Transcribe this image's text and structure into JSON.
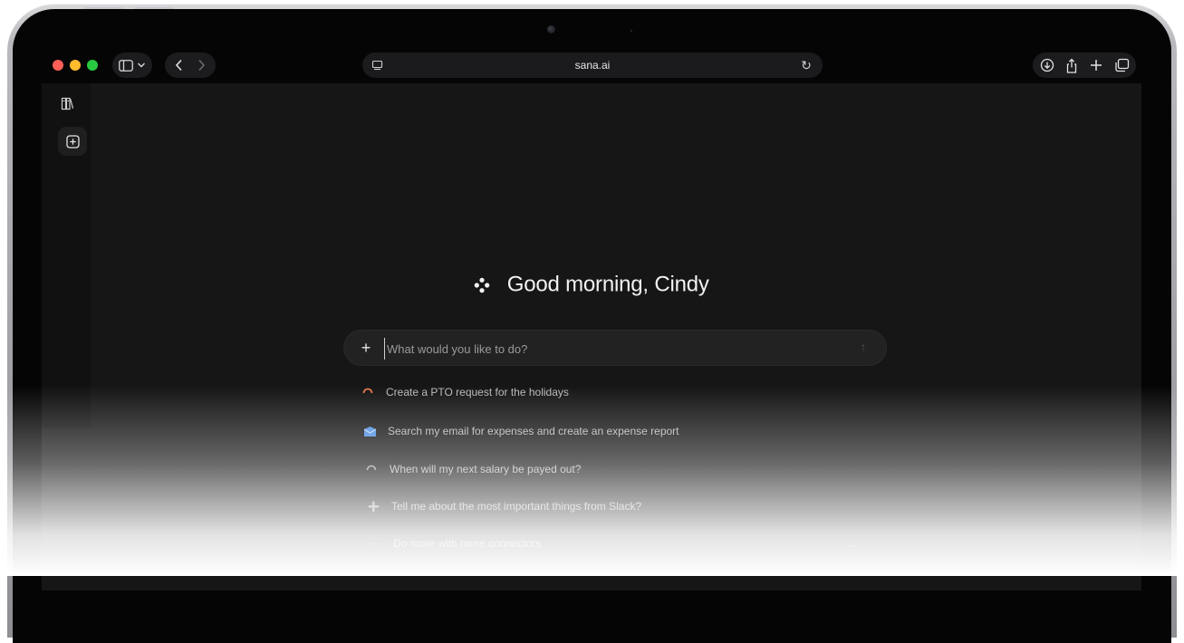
{
  "browser": {
    "url": "sana.ai",
    "traffic_lights": [
      "#ff5f57",
      "#febc2e",
      "#28c840"
    ],
    "left_icons": [
      "sidebar-toggle-icon",
      "chevron-down-icon",
      "back-arrow-icon",
      "forward-arrow-icon"
    ],
    "right_icons": [
      "download-icon",
      "share-icon",
      "new-tab-icon",
      "tab-overview-icon"
    ]
  },
  "sidebar": {
    "items": [
      {
        "icon": "library-icon"
      },
      {
        "icon": "new-chat-icon"
      }
    ]
  },
  "main": {
    "greeting": "Good morning, Cindy",
    "prompt": {
      "placeholder": "What would you like to do?"
    },
    "suggestions": [
      {
        "label": "Create a PTO request for the holidays",
        "icon": "pto-icon",
        "color": "#e0734e"
      },
      {
        "label": "Search my email for expenses and create an expense report",
        "icon": "email-icon",
        "color": "#4f8fe0"
      },
      {
        "label": "When will my next salary be payed out?",
        "icon": "salary-icon",
        "color": "#9a9a9a"
      },
      {
        "label": "Tell me about the most important things from Slack?",
        "icon": "slack-icon",
        "color": "#9a9a9a"
      },
      {
        "label": "Do more with more connectors",
        "icon": "more-icon",
        "color": "#9a9a9a"
      }
    ]
  },
  "colors": {
    "background": "#161616",
    "surface": "#222223",
    "text": "#f2f2f2"
  }
}
